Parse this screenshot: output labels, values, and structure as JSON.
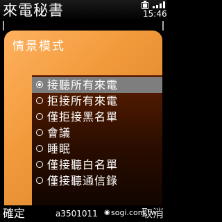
{
  "header": {
    "title": "來電秘書",
    "time": "15:46",
    "battery_icon": "battery-icon",
    "signal_icon": "signal-icon"
  },
  "panel": {
    "title": "情景模式"
  },
  "options": [
    {
      "label": "接聽所有來電",
      "selected": true
    },
    {
      "label": "拒接所有來電",
      "selected": false
    },
    {
      "label": "僅拒接黑名單",
      "selected": false
    },
    {
      "label": "會議",
      "selected": false
    },
    {
      "label": "睡眠",
      "selected": false
    },
    {
      "label": "僅接聽白名單",
      "selected": false
    },
    {
      "label": "僅接聽通信錄",
      "selected": false
    }
  ],
  "softkeys": {
    "left": "確定",
    "center": "a3501011",
    "right": "取消"
  },
  "watermark": {
    "text": "sogi.com.tw",
    "icon": "sogi-logo-icon"
  },
  "colors": {
    "panel_orange": "#f19a3c",
    "dialog_brown": "#2a0d00",
    "selection_gray": "#7e7e7e"
  }
}
